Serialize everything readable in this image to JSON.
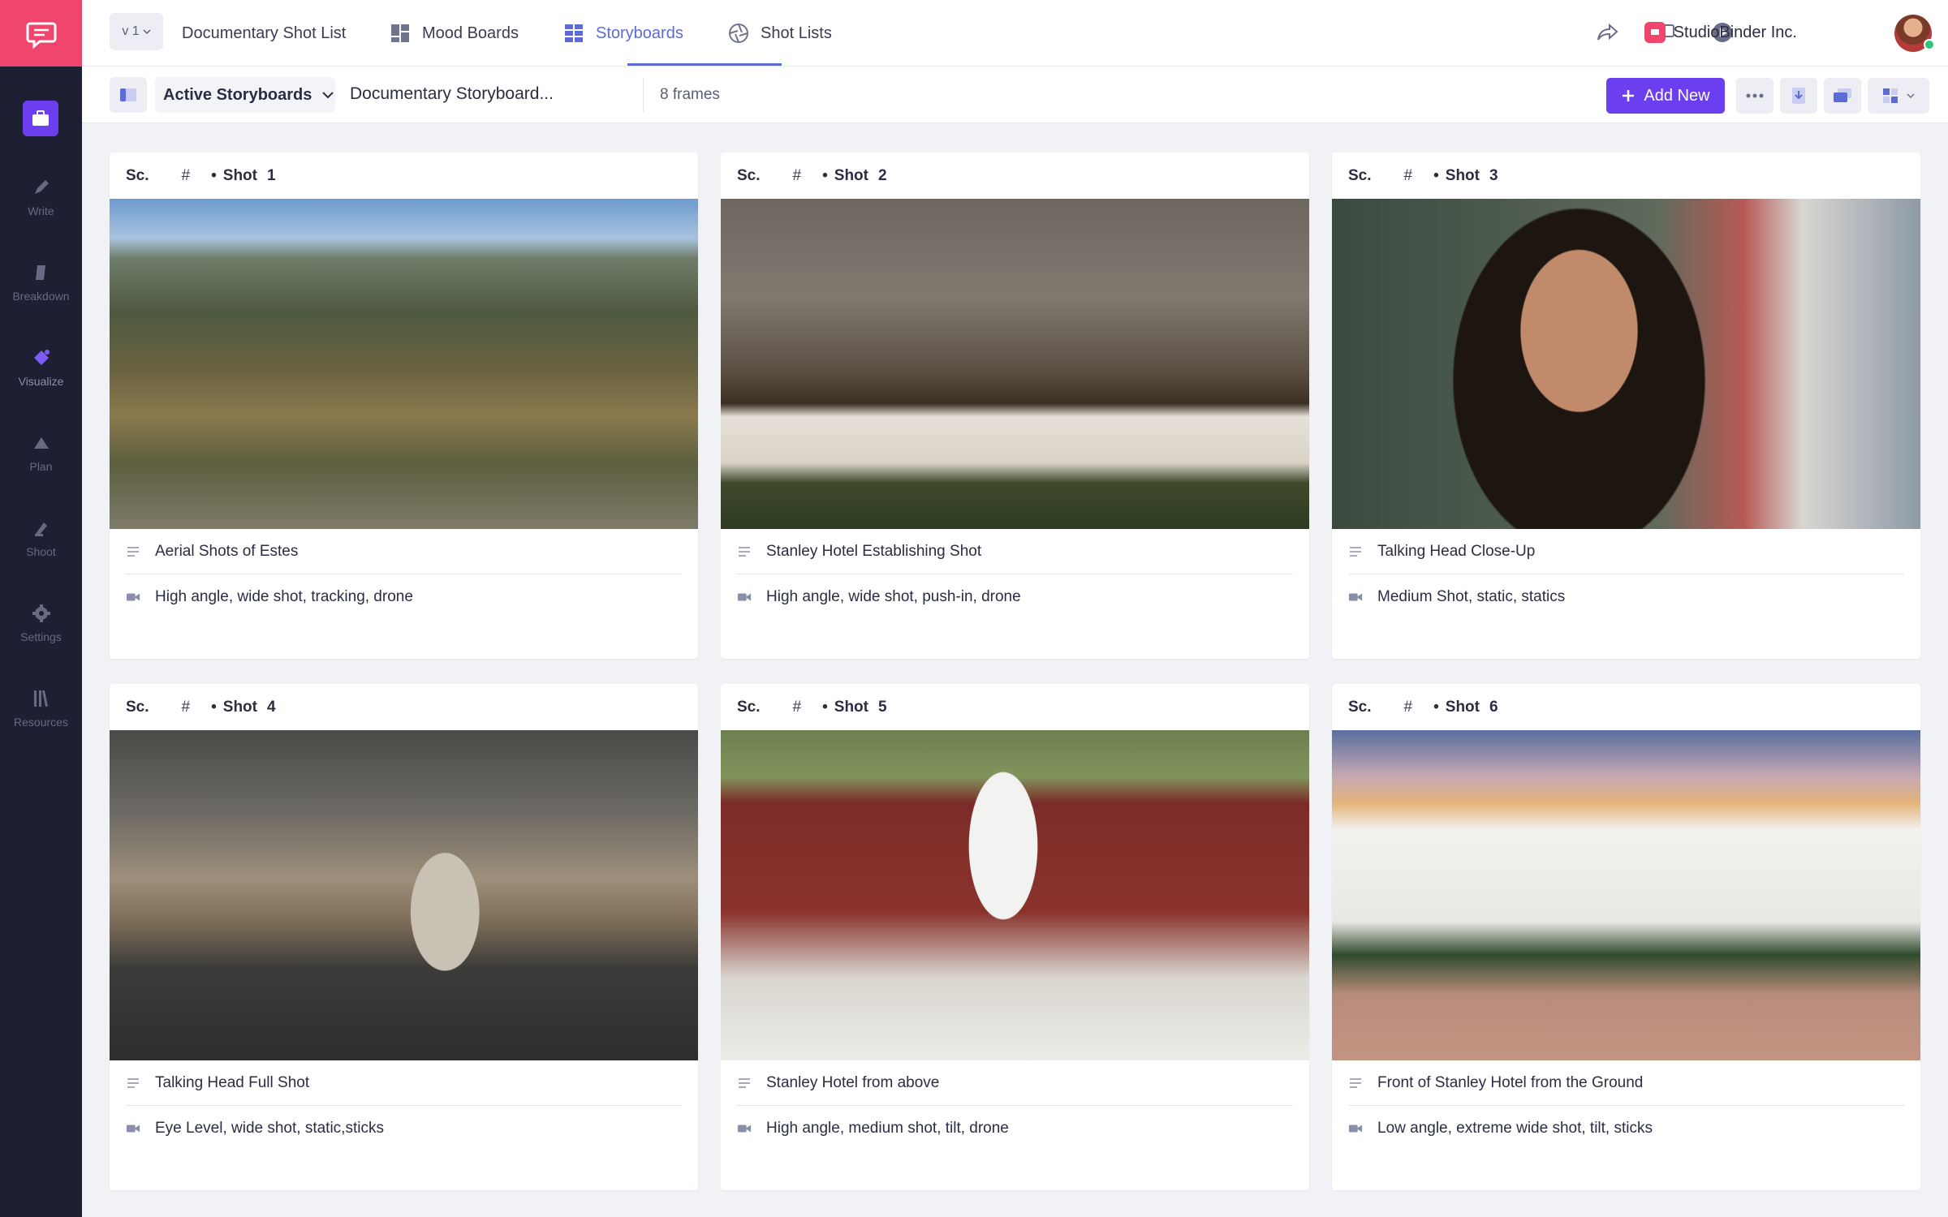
{
  "sidebar": {
    "items": [
      {
        "label": "Write",
        "icon": "pen-icon"
      },
      {
        "label": "Breakdown",
        "icon": "breakdown-icon"
      },
      {
        "label": "Visualize",
        "icon": "visualize-icon"
      },
      {
        "label": "Plan",
        "icon": "plan-icon"
      },
      {
        "label": "Shoot",
        "icon": "shoot-icon"
      },
      {
        "label": "Settings",
        "icon": "gear-icon"
      },
      {
        "label": "Resources",
        "icon": "resources-icon"
      }
    ]
  },
  "topbar": {
    "version": "v 1",
    "project": "Documentary Shot List",
    "tabs": [
      {
        "label": "Mood Boards"
      },
      {
        "label": "Storyboards"
      },
      {
        "label": "Shot Lists"
      }
    ],
    "company": "StudioBinder Inc."
  },
  "toolbar": {
    "filter": "Active Storyboards",
    "board_name": "Documentary Storyboard...",
    "frames": "8 frames",
    "add_new": "Add New"
  },
  "card_labels": {
    "sc": "Sc.",
    "hash": "#",
    "bullet": "•",
    "shot": "Shot"
  },
  "shots": [
    {
      "num": "1",
      "title": "Aerial Shots of Estes",
      "desc": "High angle, wide shot, tracking, drone"
    },
    {
      "num": "2",
      "title": "Stanley Hotel Establishing Shot",
      "desc": "High angle, wide shot, push-in, drone"
    },
    {
      "num": "3",
      "title": "Talking Head Close-Up",
      "desc": "Medium Shot, static, statics"
    },
    {
      "num": "4",
      "title": "Talking Head Full Shot",
      "desc": "Eye Level, wide shot, static,sticks"
    },
    {
      "num": "5",
      "title": "Stanley Hotel from above",
      "desc": "High angle, medium shot, tilt, drone"
    },
    {
      "num": "6",
      "title": "Front of Stanley Hotel from the Ground",
      "desc": "Low angle, extreme wide shot, tilt, sticks"
    }
  ],
  "colors": {
    "accent": "#6b3ff0",
    "brand": "#f0466d",
    "sidebar": "#1d1f33",
    "tab_active": "#5c6bd6"
  }
}
